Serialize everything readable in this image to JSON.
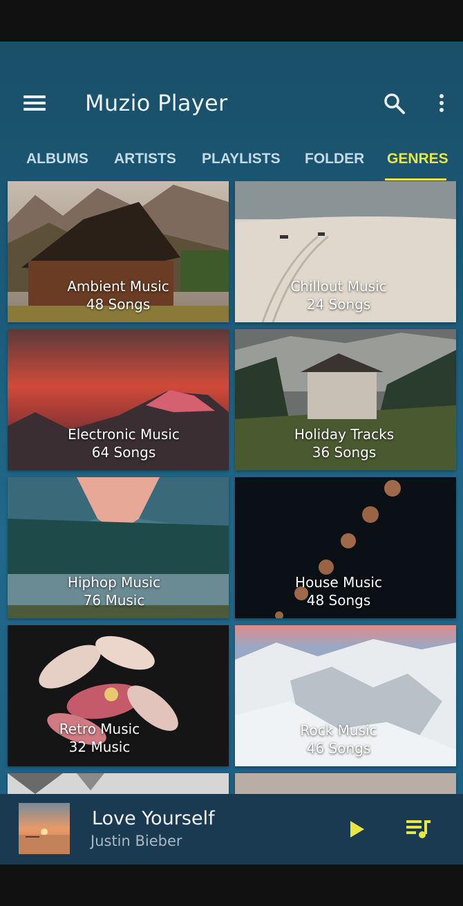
{
  "app": {
    "title": "Muzio Player",
    "accent_color": "#e8e640",
    "icons": {
      "menu": "hamburger-menu-icon",
      "search": "search-icon",
      "more": "more-vert-icon"
    }
  },
  "tabs": [
    {
      "label": "ALBUMS",
      "active": false
    },
    {
      "label": "ARTISTS",
      "active": false
    },
    {
      "label": "PLAYLISTS",
      "active": false
    },
    {
      "label": "FOLDER",
      "active": false
    },
    {
      "label": "GENRES",
      "active": true
    }
  ],
  "genres": [
    {
      "title": "Ambient Music",
      "count": "48 Songs"
    },
    {
      "title": "Chillout Music",
      "count": "24 Songs"
    },
    {
      "title": "Electronic Music",
      "count": "64 Songs"
    },
    {
      "title": "Holiday Tracks",
      "count": "36 Songs"
    },
    {
      "title": "Hiphop Music",
      "count": "76 Music"
    },
    {
      "title": "House Music",
      "count": "48 Songs"
    },
    {
      "title": "Retro Music",
      "count": "32 Music"
    },
    {
      "title": "Rock Music",
      "count": "46 Songs"
    }
  ],
  "now_playing": {
    "title": "Love Yourself",
    "artist": "Justin Bieber",
    "icons": {
      "play": "play-icon",
      "queue": "queue-music-icon"
    }
  }
}
